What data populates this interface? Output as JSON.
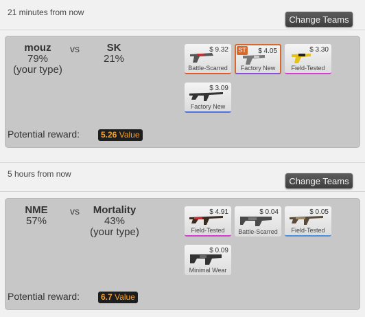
{
  "matches": [
    {
      "time": "21 minutes from now",
      "change_label": "Change Teams",
      "team1": {
        "name": "mouz",
        "pct": "79%",
        "note": "(your type)"
      },
      "vs": "vs",
      "team2": {
        "name": "SK",
        "pct": "21%",
        "note": ""
      },
      "items": [
        {
          "price": "$ 9.32",
          "condition": "Battle-Scarred",
          "color": "#e05a2a",
          "stattrak": "",
          "icon": "pistol-icon"
        },
        {
          "price": "$ 4.05",
          "condition": "Factory New",
          "color": "#8a4fd6",
          "stattrak": "ST",
          "icon": "pistol-icon"
        },
        {
          "price": "$ 3.30",
          "condition": "Field-Tested",
          "color": "#d63bd6",
          "stattrak": "",
          "icon": "pistol-icon"
        },
        {
          "price": "$ 3.09",
          "condition": "Factory New",
          "color": "#4d6fe0",
          "stattrak": "",
          "icon": "rifle-icon"
        }
      ],
      "reward_label": "Potential reward:",
      "reward_value": "5.26",
      "reward_unit": "Value"
    },
    {
      "time": "5 hours from now",
      "change_label": "Change Teams",
      "team1": {
        "name": "NME",
        "pct": "57%",
        "note": ""
      },
      "vs": "vs",
      "team2": {
        "name": "Mortality",
        "pct": "43%",
        "note": "(your type)"
      },
      "items": [
        {
          "price": "$ 4.91",
          "condition": "Field-Tested",
          "color": "#d63bd6",
          "stattrak": "",
          "icon": "rifle-icon"
        },
        {
          "price": "$ 0.04",
          "condition": "Battle-Scarred",
          "color": "#bbbbbb",
          "stattrak": "",
          "icon": "smg-icon"
        },
        {
          "price": "$ 0.05",
          "condition": "Field-Tested",
          "color": "#4d8fe0",
          "stattrak": "",
          "icon": "rifle-icon"
        },
        {
          "price": "$ 0.09",
          "condition": "Minimal Wear",
          "color": "#bbbbbb",
          "stattrak": "",
          "icon": "smg-icon"
        }
      ],
      "reward_label": "Potential reward:",
      "reward_value": "6.7",
      "reward_unit": "Value"
    }
  ]
}
